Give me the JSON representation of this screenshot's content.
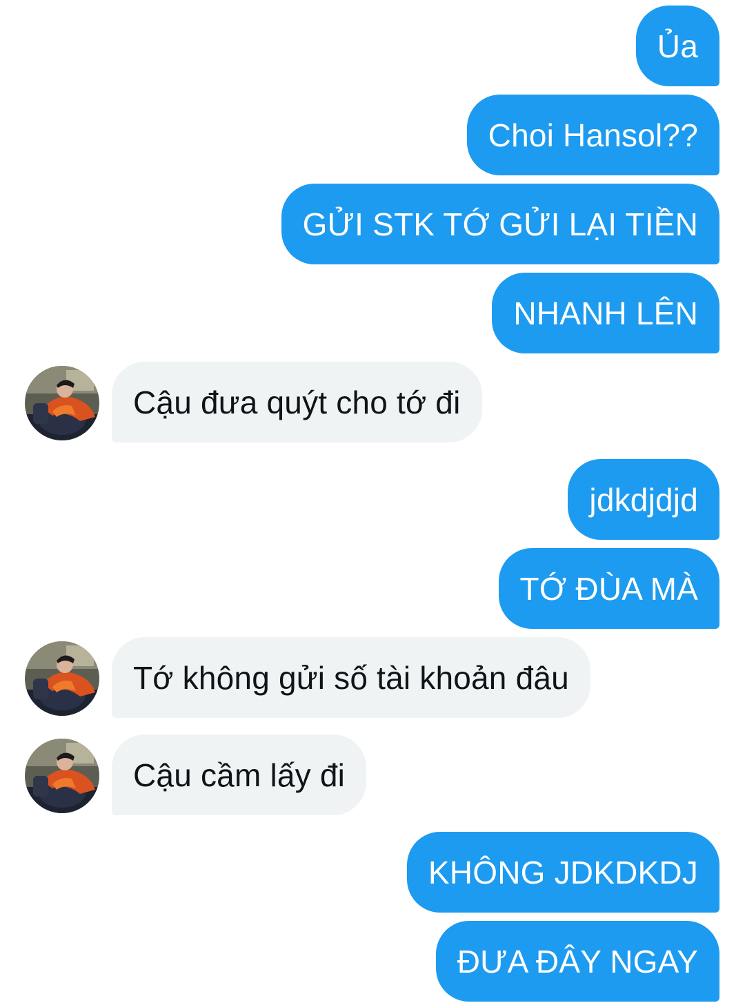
{
  "conversation": {
    "messages": [
      {
        "sender": "me",
        "text": "Ủa"
      },
      {
        "sender": "me",
        "text": "Choi Hansol??"
      },
      {
        "sender": "me",
        "text": "GỬI STK TỚ GỬI LẠI TIỀN"
      },
      {
        "sender": "me",
        "text": "NHANH LÊN"
      },
      {
        "sender": "them",
        "text": "Cậu đưa quýt cho tớ đi"
      },
      {
        "sender": "me",
        "text": "jdkdjdjd"
      },
      {
        "sender": "me",
        "text": "TỚ ĐÙA MÀ"
      },
      {
        "sender": "them",
        "text": "Tớ không gửi số tài khoản đâu"
      },
      {
        "sender": "them",
        "text": "Cậu cầm lấy đi"
      },
      {
        "sender": "me",
        "text": "KHÔNG JDKDKDJ"
      },
      {
        "sender": "me",
        "text": "ĐƯA ĐÂY NGAY"
      }
    ]
  },
  "colors": {
    "sent_bubble": "#1d9bf0",
    "received_bubble": "#eff3f4",
    "background": "#ffffff"
  },
  "icons": {
    "contact_avatar": "avatar-photo"
  }
}
